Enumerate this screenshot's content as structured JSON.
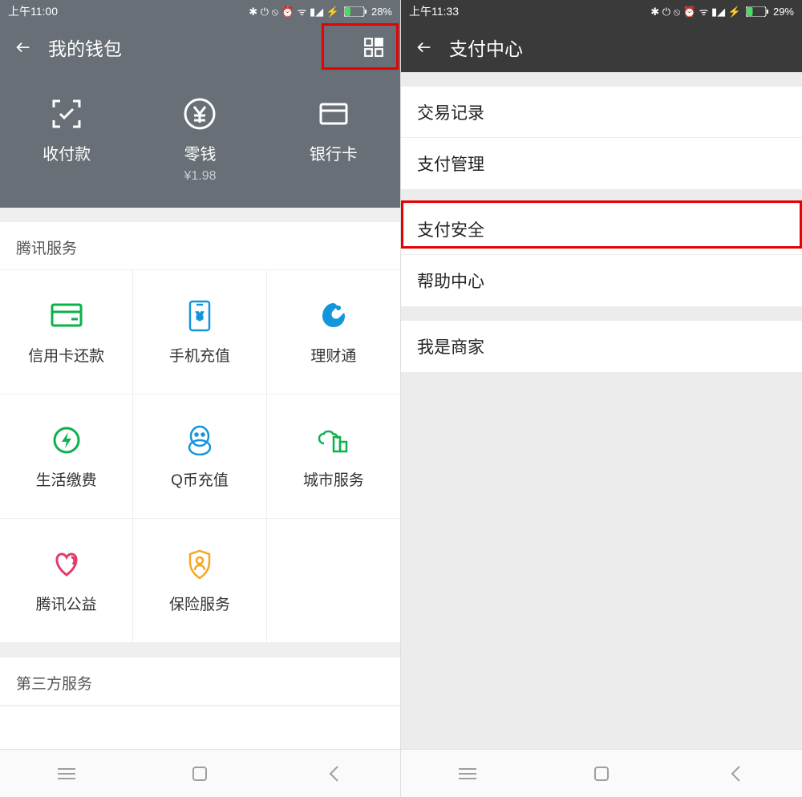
{
  "left": {
    "status": {
      "time": "上午11:00",
      "battery": "28%"
    },
    "header": {
      "title": "我的钱包"
    },
    "hero": [
      {
        "label": "收付款",
        "sub": ""
      },
      {
        "label": "零钱",
        "sub": "¥1.98"
      },
      {
        "label": "银行卡",
        "sub": ""
      }
    ],
    "services_title": "腾讯服务",
    "services": [
      {
        "label": "信用卡还款"
      },
      {
        "label": "手机充值"
      },
      {
        "label": "理财通"
      },
      {
        "label": "生活缴费"
      },
      {
        "label": "Q币充值"
      },
      {
        "label": "城市服务"
      },
      {
        "label": "腾讯公益"
      },
      {
        "label": "保险服务"
      }
    ],
    "third_party_title": "第三方服务"
  },
  "right": {
    "status": {
      "time": "上午11:33",
      "battery": "29%"
    },
    "header": {
      "title": "支付中心"
    },
    "group1": [
      {
        "label": "交易记录"
      },
      {
        "label": "支付管理"
      }
    ],
    "group2": [
      {
        "label": "支付安全"
      },
      {
        "label": "帮助中心"
      }
    ],
    "group3": [
      {
        "label": "我是商家"
      }
    ]
  }
}
